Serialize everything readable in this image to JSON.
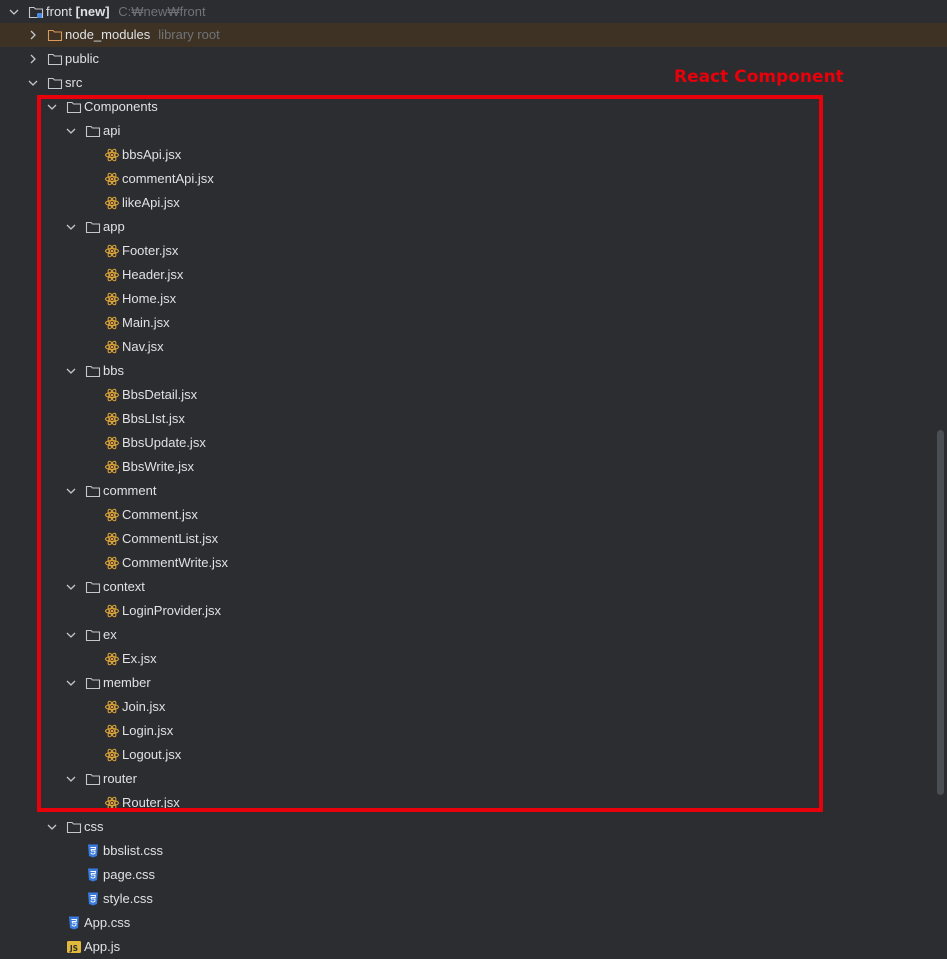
{
  "project": {
    "name": "front",
    "tag": "[new]",
    "path": "C:₩new₩front"
  },
  "node_modules": {
    "label": "node_modules",
    "hint": "library root"
  },
  "public_folder": {
    "label": "public"
  },
  "src_folder": {
    "label": "src"
  },
  "components_folder": {
    "label": "Components"
  },
  "annotation": {
    "text": "React Component",
    "color": "#e8000b"
  },
  "tree": [
    {
      "label": "api",
      "type": "folder",
      "depth": 3
    },
    {
      "label": "bbsApi.jsx",
      "type": "react",
      "depth": 4
    },
    {
      "label": "commentApi.jsx",
      "type": "react",
      "depth": 4
    },
    {
      "label": "likeApi.jsx",
      "type": "react",
      "depth": 4
    },
    {
      "label": "app",
      "type": "folder",
      "depth": 3
    },
    {
      "label": "Footer.jsx",
      "type": "react",
      "depth": 4
    },
    {
      "label": "Header.jsx",
      "type": "react",
      "depth": 4
    },
    {
      "label": "Home.jsx",
      "type": "react",
      "depth": 4
    },
    {
      "label": "Main.jsx",
      "type": "react",
      "depth": 4
    },
    {
      "label": "Nav.jsx",
      "type": "react",
      "depth": 4
    },
    {
      "label": "bbs",
      "type": "folder",
      "depth": 3
    },
    {
      "label": "BbsDetail.jsx",
      "type": "react",
      "depth": 4
    },
    {
      "label": "BbsLIst.jsx",
      "type": "react",
      "depth": 4
    },
    {
      "label": "BbsUpdate.jsx",
      "type": "react",
      "depth": 4
    },
    {
      "label": "BbsWrite.jsx",
      "type": "react",
      "depth": 4
    },
    {
      "label": "comment",
      "type": "folder",
      "depth": 3
    },
    {
      "label": "Comment.jsx",
      "type": "react",
      "depth": 4
    },
    {
      "label": "CommentList.jsx",
      "type": "react",
      "depth": 4
    },
    {
      "label": "CommentWrite.jsx",
      "type": "react",
      "depth": 4
    },
    {
      "label": "context",
      "type": "folder",
      "depth": 3
    },
    {
      "label": "LoginProvider.jsx",
      "type": "react",
      "depth": 4
    },
    {
      "label": "ex",
      "type": "folder",
      "depth": 3
    },
    {
      "label": "Ex.jsx",
      "type": "react",
      "depth": 4
    },
    {
      "label": "member",
      "type": "folder",
      "depth": 3
    },
    {
      "label": "Join.jsx",
      "type": "react",
      "depth": 4
    },
    {
      "label": "Login.jsx",
      "type": "react",
      "depth": 4
    },
    {
      "label": "Logout.jsx",
      "type": "react",
      "depth": 4
    },
    {
      "label": "router",
      "type": "folder",
      "depth": 3
    },
    {
      "label": "Router.jsx",
      "type": "react",
      "depth": 4
    },
    {
      "label": "css",
      "type": "folder",
      "depth": 2
    },
    {
      "label": "bbslist.css",
      "type": "css",
      "depth": 3
    },
    {
      "label": "page.css",
      "type": "css",
      "depth": 3
    },
    {
      "label": "style.css",
      "type": "css",
      "depth": 3
    },
    {
      "label": "App.css",
      "type": "css",
      "depth": 2
    },
    {
      "label": "App.js",
      "type": "js",
      "depth": 2
    }
  ],
  "colors": {
    "background": "#2b2d30",
    "text": "#dfe1e5",
    "hint": "#6f737a",
    "react_icon": "#e2a73a",
    "css_icon": "#3a7be0",
    "js_icon": "#e2b93a",
    "lib_row": "#3d3223"
  }
}
